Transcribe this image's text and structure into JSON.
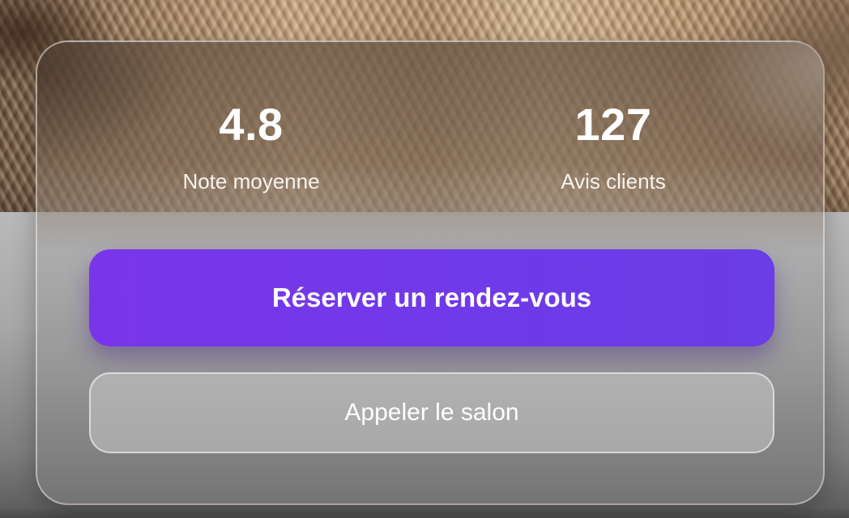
{
  "stats": {
    "rating": {
      "value": "4.8",
      "label": "Note moyenne"
    },
    "reviews": {
      "value": "127",
      "label": "Avis clients"
    }
  },
  "actions": {
    "book_label": "Réserver un rendez-vous",
    "call_label": "Appeler le salon"
  },
  "colors": {
    "primary_button": "#7339E8",
    "text": "#FFFFFF"
  }
}
